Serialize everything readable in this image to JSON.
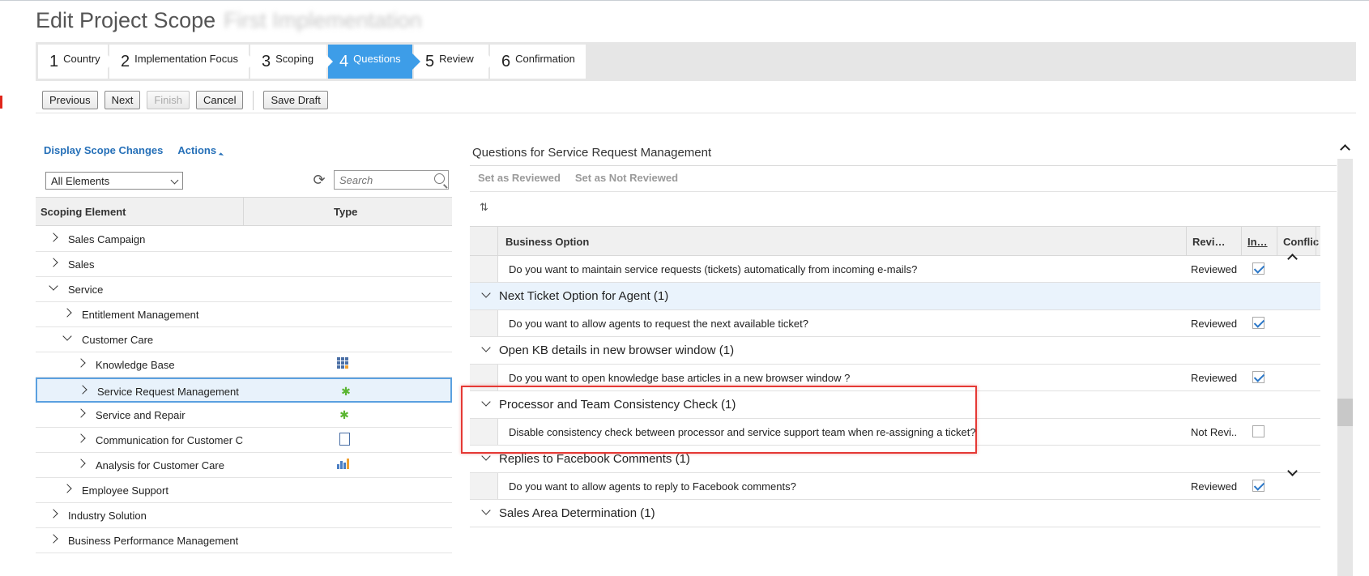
{
  "page": {
    "title": "Edit Project Scope",
    "subtitle_blurred": "First Implementation"
  },
  "wizard": {
    "steps": [
      {
        "num": "1",
        "label": "Country"
      },
      {
        "num": "2",
        "label": "Implementation Focus"
      },
      {
        "num": "3",
        "label": "Scoping"
      },
      {
        "num": "4",
        "label": "Questions"
      },
      {
        "num": "5",
        "label": "Review"
      },
      {
        "num": "6",
        "label": "Confirmation"
      }
    ],
    "active_step": "4"
  },
  "toolbar": {
    "previous": "Previous",
    "next": "Next",
    "finish": "Finish",
    "cancel": "Cancel",
    "save_draft": "Save Draft"
  },
  "left": {
    "display_scope_changes": "Display Scope Changes",
    "actions": "Actions",
    "filter_value": "All Elements",
    "search_placeholder": "Search",
    "col_scoping_element": "Scoping Element",
    "col_type": "Type",
    "tree": [
      {
        "label": "Sales Campaign",
        "level": 0,
        "expanded": false,
        "icon": ""
      },
      {
        "label": "Sales",
        "level": 0,
        "expanded": false,
        "icon": ""
      },
      {
        "label": "Service",
        "level": 0,
        "expanded": true,
        "icon": ""
      },
      {
        "label": "Entitlement Management",
        "level": 1,
        "expanded": false,
        "icon": ""
      },
      {
        "label": "Customer Care",
        "level": 1,
        "expanded": true,
        "icon": ""
      },
      {
        "label": "Knowledge Base",
        "level": 2,
        "expanded": false,
        "icon": "knowledge-grid-icon"
      },
      {
        "label": "Service Request Management",
        "level": 2,
        "expanded": false,
        "icon": "gear-icon",
        "selected": true
      },
      {
        "label": "Service and Repair",
        "level": 2,
        "expanded": false,
        "icon": "gear-icon"
      },
      {
        "label": "Communication for Customer C",
        "level": 2,
        "expanded": false,
        "icon": "document-icon"
      },
      {
        "label": "Analysis for Customer Care",
        "level": 2,
        "expanded": false,
        "icon": "bar-chart-icon"
      },
      {
        "label": "Employee Support",
        "level": 1,
        "expanded": false,
        "icon": ""
      },
      {
        "label": "Industry Solution",
        "level": 0,
        "expanded": false,
        "icon": ""
      },
      {
        "label": "Business Performance Management",
        "level": 0,
        "expanded": false,
        "icon": ""
      }
    ]
  },
  "right": {
    "title": "Questions for Service Request Management",
    "set_reviewed": "Set as Reviewed",
    "set_not_reviewed": "Set as Not Reviewed",
    "col_business_option": "Business Option",
    "col_reviewed": "Revi…",
    "col_in": "In…",
    "col_conflict": "Conflic",
    "rows": [
      {
        "kind": "q",
        "text": "Do you want to maintain service requests (tickets) automatically from incoming e-mails?",
        "status": "Reviewed",
        "checked": true
      },
      {
        "kind": "g",
        "text": "Next Ticket Option for Agent (1)",
        "highlight": true
      },
      {
        "kind": "q",
        "text": "Do you want to allow agents to request the next available ticket?",
        "status": "Reviewed",
        "checked": true
      },
      {
        "kind": "g",
        "text": "Open KB details in new browser window (1)"
      },
      {
        "kind": "q",
        "text": "Do you want to open knowledge base articles in a new browser window ?",
        "status": "Reviewed",
        "checked": true
      },
      {
        "kind": "g",
        "text": "Processor and Team Consistency Check (1)"
      },
      {
        "kind": "q",
        "text": "Disable consistency check between processor and service support team when re-assigning a ticket?",
        "status": "Not Revi..",
        "checked": false
      },
      {
        "kind": "g",
        "text": "Replies to Facebook Comments (1)"
      },
      {
        "kind": "q",
        "text": "Do you want to allow agents to reply to Facebook comments?",
        "status": "Reviewed",
        "checked": true
      },
      {
        "kind": "g",
        "text": "Sales Area Determination (1)"
      }
    ]
  },
  "colors": {
    "active_step": "#3d9de8",
    "link": "#2670b8",
    "highlight_box": "#e53935"
  }
}
